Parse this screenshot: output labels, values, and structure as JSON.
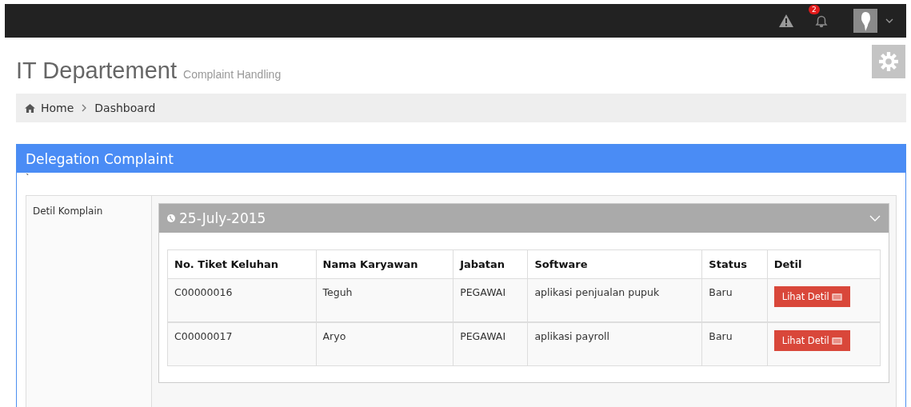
{
  "topbar": {
    "notification_count": "2"
  },
  "header": {
    "title": "IT Departement",
    "subtitle": "Complaint Handling"
  },
  "breadcrumb": [
    "Home",
    "Dashboard"
  ],
  "panel": {
    "title": "Delegation Complaint",
    "mark": "`",
    "field_label": "Detil Komplain",
    "group": {
      "date": "25-July-2015",
      "expanded": true,
      "columns": [
        "No. Tiket Keluhan",
        "Nama Karyawan",
        "Jabatan",
        "Software",
        "Status",
        "Detil"
      ],
      "rows": [
        {
          "ticket": "C00000016",
          "name": "Teguh",
          "position": "PEGAWAI",
          "software": "aplikasi penjualan pupuk",
          "status": "Baru",
          "action": "Lihat Detil"
        },
        {
          "ticket": "C00000017",
          "name": "Aryo",
          "position": "PEGAWAI",
          "software": "aplikasi payroll",
          "status": "Baru",
          "action": "Lihat Detil"
        }
      ]
    }
  }
}
